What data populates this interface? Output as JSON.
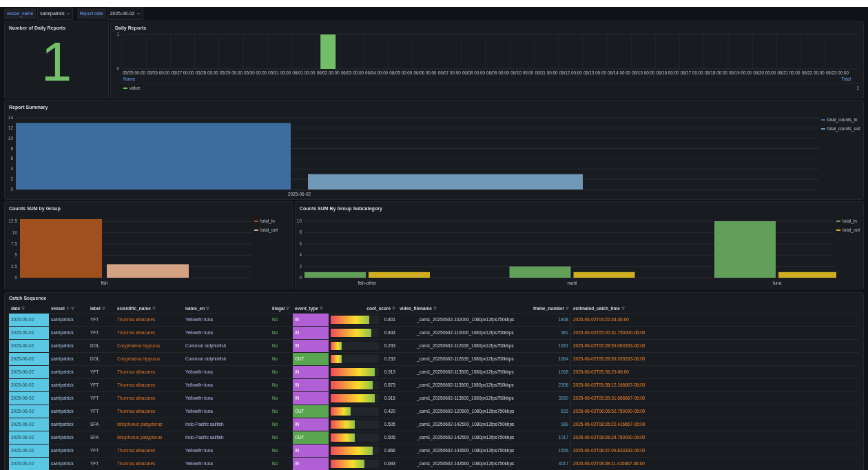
{
  "variables": [
    {
      "label": "vessel_name",
      "value": "saintpatrick"
    },
    {
      "label": "Report date",
      "value": "2025-06-02"
    }
  ],
  "stat_panel": {
    "title": "Number of Daily Reports",
    "value": "1",
    "color": "#73bf69"
  },
  "daily_reports": {
    "title": "Daily Reports",
    "chart_data": {
      "type": "bar",
      "categories": [
        "05/25 00:00",
        "05/26 00:00",
        "05/27 00:00",
        "05/28 00:00",
        "05/29 00:00",
        "05/30 00:00",
        "05/31 00:00",
        "06/01 00:00",
        "06/02 00:00",
        "06/03 00:00",
        "06/04 00:00",
        "06/05 00:00",
        "06/06 00:00",
        "06/07 00:00",
        "06/08 00:00",
        "06/09 00:00",
        "06/10 00:00",
        "06/11 00:00",
        "06/12 00:00",
        "06/13 00:00",
        "06/14 00:00",
        "06/15 00:00",
        "06/16 00:00",
        "06/17 00:00",
        "06/18 00:00",
        "06/19 00:00",
        "06/20 00:00",
        "06/21 00:00",
        "06/22 00:00",
        "06/23 00:00"
      ],
      "series": [
        {
          "name": "value",
          "color": "#73bf69",
          "values": [
            0,
            0,
            0,
            0,
            0,
            0,
            0,
            0,
            1,
            0,
            0,
            0,
            0,
            0,
            0,
            0,
            0,
            0,
            0,
            0,
            0,
            0,
            0,
            0,
            0,
            0,
            0,
            0,
            0,
            0
          ]
        }
      ],
      "ylim": [
        0,
        1
      ],
      "yticks": [
        0,
        1
      ],
      "grid": true
    },
    "legend": {
      "name_header": "Name",
      "total_header": "Total",
      "totals": [
        "1"
      ]
    }
  },
  "report_summary": {
    "title": "Report Summary",
    "chart_data": {
      "type": "bar",
      "categories": [
        "2025-06-02"
      ],
      "series": [
        {
          "name": "total_counts_in",
          "color": "#3d6c9e",
          "values": [
            13
          ]
        },
        {
          "name": "total_counts_out",
          "color": "#7099b8",
          "values": [
            3
          ]
        }
      ],
      "ylim": [
        0,
        14
      ],
      "yticks": [
        0,
        2,
        4,
        6,
        8,
        10,
        12,
        14
      ],
      "grid": true
    }
  },
  "counts_by_group": {
    "title": "Counts SUM by Group",
    "chart_data": {
      "type": "bar",
      "categories": [
        "fish"
      ],
      "series": [
        {
          "name": "total_in",
          "color": "#a0501c",
          "values": [
            13
          ]
        },
        {
          "name": "total_out",
          "color": "#d4a383",
          "values": [
            3
          ]
        }
      ],
      "ylim": [
        0,
        13
      ],
      "yticks": [
        0,
        2.5,
        5,
        7.5,
        10,
        12.5
      ],
      "grid": true
    }
  },
  "counts_by_subcategory": {
    "title": "Counts SUM By Group Subcategory",
    "chart_data": {
      "type": "bar",
      "categories": [
        "fish-other",
        "mahi",
        "tuna"
      ],
      "series": [
        {
          "name": "total_in",
          "color": "#62a05a",
          "values": [
            1,
            2,
            10
          ]
        },
        {
          "name": "total_out",
          "color": "#cfae1f",
          "values": [
            1,
            1,
            1
          ]
        }
      ],
      "ylim": [
        0,
        10
      ],
      "yticks": [
        0,
        2,
        4,
        6,
        8,
        10
      ],
      "grid": true
    }
  },
  "catch_sequence": {
    "title": "Catch Sequence",
    "columns": [
      {
        "label": "date",
        "sorted": false
      },
      {
        "label": "vessel",
        "sorted": true
      },
      {
        "label": "label",
        "sorted": false
      },
      {
        "label": "scientific_name",
        "sorted": false
      },
      {
        "label": "name_en",
        "sorted": false
      },
      {
        "label": "illegal",
        "sorted": false
      },
      {
        "label": "event_type",
        "sorted": false
      },
      {
        "label": "conf_score",
        "sorted": false
      },
      {
        "label": "video_filename",
        "sorted": false
      },
      {
        "label": "frame_number",
        "sorted": false
      },
      {
        "label": "estimated_catch_time",
        "sorted": false
      }
    ],
    "rows": [
      {
        "date": "2025-06-02",
        "vessel": "saintpatrick",
        "label": "YFT",
        "scientific_name": "Thunnus albacares",
        "name_en": "Yellowfin tuna",
        "illegal": "No",
        "event": {
          "label": "IN",
          "color": "#b05fd4"
        },
        "conf": {
          "reading": "0.801",
          "level": 0.801
        },
        "video_filename": "_cam1_20250602-102000_1080px12fps750kbps",
        "frame_number": "1848",
        "estimated_catch_time": "2025-06-02T04:22:34-06:00"
      },
      {
        "date": "2025-06-02",
        "vessel": "saintpatrick",
        "label": "YFT",
        "scientific_name": "Thunnus albacares",
        "name_en": "Yellowfin tuna",
        "illegal": "No",
        "event": {
          "label": "IN",
          "color": "#b05fd4"
        },
        "conf": {
          "reading": "0.843",
          "level": 0.843
        },
        "video_filename": "_cam1_20250602-110000_1080px12fps750kbps",
        "frame_number": "381",
        "estimated_catch_time": "2025-06-02T05:00:31.750000-06:00"
      },
      {
        "date": "2025-06-02",
        "vessel": "saintpatrick",
        "label": "DOL",
        "scientific_name": "Coryphaena hippurus",
        "name_en": "Common dolphinfish",
        "illegal": "No",
        "event": {
          "label": "IN",
          "color": "#b05fd4"
        },
        "conf": {
          "reading": "0.233",
          "level": 0.233
        },
        "video_filename": "_cam1_20250602-112639_1080px12fps750kbps",
        "frame_number": "1681",
        "estimated_catch_time": "2025-06-02T05:28:59.083333-06:00"
      },
      {
        "date": "2025-06-02",
        "vessel": "saintpatrick",
        "label": "DOL",
        "scientific_name": "Coryphaena hippurus",
        "name_en": "Common dolphinfish",
        "illegal": "No",
        "event": {
          "label": "OUT",
          "color": "#5aa54f"
        },
        "conf": {
          "reading": "0.233",
          "level": 0.233
        },
        "video_filename": "_cam1_20250602-112639_1080px12fps750kbps",
        "frame_number": "1684",
        "estimated_catch_time": "2025-06-02T05:28:59.333333-06:00"
      },
      {
        "date": "2025-06-02",
        "vessel": "saintpatrick",
        "label": "YFT",
        "scientific_name": "Thunnus albacares",
        "name_en": "Yellowfin tuna",
        "illegal": "No",
        "event": {
          "label": "IN",
          "color": "#b05fd4"
        },
        "conf": {
          "reading": "0.913",
          "level": 0.913
        },
        "video_filename": "_cam1_20250602-113500_1080px12fps750kbps",
        "frame_number": "1068",
        "estimated_catch_time": "2025-06-02T05:36:29-06:00"
      },
      {
        "date": "2025-06-02",
        "vessel": "saintpatrick",
        "label": "YFT",
        "scientific_name": "Thunnus albacares",
        "name_en": "Yellowfin tuna",
        "illegal": "No",
        "event": {
          "label": "IN",
          "color": "#b05fd4"
        },
        "conf": {
          "reading": "0.873",
          "level": 0.873
        },
        "video_filename": "_cam1_20250602-113500_1080px12fps750kbps",
        "frame_number": "2306",
        "estimated_catch_time": "2025-06-02T05:38:12.166667-06:00"
      },
      {
        "date": "2025-06-02",
        "vessel": "saintpatrick",
        "label": "YFT",
        "scientific_name": "Thunnus albacares",
        "name_en": "Yellowfin tuna",
        "illegal": "No",
        "event": {
          "label": "IN",
          "color": "#b05fd4"
        },
        "conf": {
          "reading": "0.915",
          "level": 0.915
        },
        "video_filename": "_cam1_20250602-113500_1080px12fps750kbps",
        "frame_number": "3260",
        "estimated_catch_time": "2025-06-02T05:39:31.666667-06:00"
      },
      {
        "date": "2025-06-02",
        "vessel": "saintpatrick",
        "label": "YFT",
        "scientific_name": "Thunnus albacares",
        "name_en": "Yellowfin tuna",
        "illegal": "No",
        "event": {
          "label": "OUT",
          "color": "#5aa54f"
        },
        "conf": {
          "reading": "0.420",
          "level": 0.42
        },
        "video_filename": "_cam1_20250602-120500_1080px12fps750kbps",
        "frame_number": "633",
        "estimated_catch_time": "2025-06-02T06:05:52.750000-06:00"
      },
      {
        "date": "2025-06-02",
        "vessel": "saintpatrick",
        "label": "SFA",
        "scientific_name": "Istiophorus platypterus",
        "name_en": "Indo-Pacific sailfish",
        "illegal": "No",
        "event": {
          "label": "IN",
          "color": "#b05fd4"
        },
        "conf": {
          "reading": "0.505",
          "level": 0.505
        },
        "video_filename": "_cam1_20250602-142500_1080px12fps750kbps",
        "frame_number": "989",
        "estimated_catch_time": "2025-06-02T08:26:22.416667-06:00"
      },
      {
        "date": "2025-06-02",
        "vessel": "saintpatrick",
        "label": "SFA",
        "scientific_name": "Istiophorus platypterus",
        "name_en": "Indo-Pacific sailfish",
        "illegal": "No",
        "event": {
          "label": "OUT",
          "color": "#5aa54f"
        },
        "conf": {
          "reading": "0.505",
          "level": 0.505
        },
        "video_filename": "_cam1_20250602-142500_1080px12fps750kbps",
        "frame_number": "1017",
        "estimated_catch_time": "2025-06-02T08:26:24.750000-06:00"
      },
      {
        "date": "2025-06-02",
        "vessel": "saintpatrick",
        "label": "YFT",
        "scientific_name": "Thunnus albacares",
        "name_en": "Yellowfin tuna",
        "illegal": "No",
        "event": {
          "label": "IN",
          "color": "#b05fd4"
        },
        "conf": {
          "reading": "0.866",
          "level": 0.866
        },
        "video_filename": "_cam1_20250602-143500_1080px12fps750kbps",
        "frame_number": "1556",
        "estimated_catch_time": "2025-06-02T08:37:09.833333-06:00"
      },
      {
        "date": "2025-06-02",
        "vessel": "saintpatrick",
        "label": "YFT",
        "scientific_name": "Thunnus albacares",
        "name_en": "Yellowfin tuna",
        "illegal": "No",
        "event": {
          "label": "IN",
          "color": "#b05fd4"
        },
        "conf": {
          "reading": "0.693",
          "level": 0.693
        },
        "video_filename": "_cam1_20250602-143500_1080px12fps750kbps",
        "frame_number": "3017",
        "estimated_catch_time": "2025-06-02T08:39:11.416667-06:00"
      }
    ]
  }
}
